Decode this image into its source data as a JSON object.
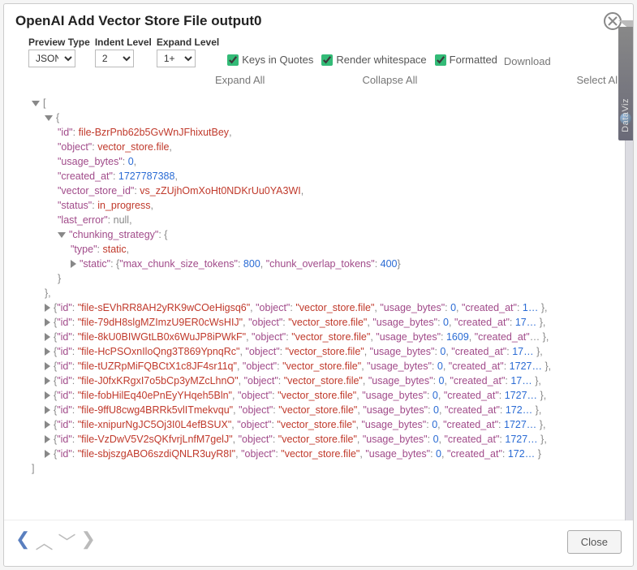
{
  "title": "OpenAI Add Vector Store File output0",
  "toolbar": {
    "preview_type_label": "Preview Type",
    "preview_type_value": "JSON",
    "indent_label": "Indent Level",
    "indent_value": "2",
    "expand_label": "Expand Level",
    "expand_value": "1+",
    "keys_in_quotes_label": "Keys in Quotes",
    "keys_in_quotes": true,
    "render_ws_label": "Render whitespace",
    "render_ws": true,
    "formatted_label": "Formatted",
    "formatted": true,
    "download_label": "Download",
    "expand_all_label": "Expand All",
    "collapse_all_label": "Collapse All",
    "select_all_label": "Select All"
  },
  "side_tab_label": "DataViz",
  "json": {
    "root_open": "[",
    "root_close": "]",
    "first_item": {
      "id_key": "\"id\"",
      "id_val": "file-BzrPnb62b5GvWnJFhixutBey",
      "object_key": "\"object\"",
      "object_val": "vector_store.file",
      "usage_key": "\"usage_bytes\"",
      "usage_val": "0",
      "created_key": "\"created_at\"",
      "created_val": "1727787388",
      "vsid_key": "\"vector_store_id\"",
      "vsid_val": "vs_zZUjhOmXoHt0NDKrUu0YA3WI",
      "status_key": "\"status\"",
      "status_val": "in_progress",
      "lasterr_key": "\"last_error\"",
      "lasterr_val": "null",
      "chunk_key": "\"chunking_strategy\"",
      "type_key": "\"type\"",
      "type_val": "static",
      "static_key": "\"static\"",
      "max_key": "\"max_chunk_size_tokens\"",
      "max_val": "800",
      "overlap_key": "\"chunk_overlap_tokens\"",
      "overlap_val": "400"
    },
    "collapsed": [
      {
        "id": "file-sEVhRR8AH2yRK9wCOeHigsq6",
        "object": "vector_store.file",
        "usage": "0",
        "created": "1…"
      },
      {
        "id": "file-79dH8slgMZImzU9ER0cWsHIJ",
        "object": "vector_store.file",
        "usage": "0",
        "created": "17…"
      },
      {
        "id": "file-8kU0BIWGtLB0x6WuJP8iPWkF",
        "object": "vector_store.file",
        "usage": "1609",
        "created": ""
      },
      {
        "id": "file-HcPSOxnIloQng3T869YpnqRc",
        "object": "vector_store.file",
        "usage": "0",
        "created": "17…"
      },
      {
        "id": "file-tUZRpMiFQBCtX1c8JF4sr11q",
        "object": "vector_store.file",
        "usage": "0",
        "created": "1727…"
      },
      {
        "id": "file-J0fxKRgxI7o5bCp3yMZcLhnO",
        "object": "vector_store.file",
        "usage": "0",
        "created": "17…"
      },
      {
        "id": "file-fobHilEq40ePnEyYHqeh5Bln",
        "object": "vector_store.file",
        "usage": "0",
        "created": "1727…"
      },
      {
        "id": "file-9ffU8cwg4BRRk5vlITmekvqu",
        "object": "vector_store.file",
        "usage": "0",
        "created": "172…"
      },
      {
        "id": "file-xnipurNgJC5Oj3I0L4efBSUX",
        "object": "vector_store.file",
        "usage": "0",
        "created": "1727…"
      },
      {
        "id": "file-VzDwV5V2sQKfvrjLnfM7gelJ",
        "object": "vector_store.file",
        "usage": "0",
        "created": "1727…"
      },
      {
        "id": "file-sbjszgABO6szdiQNLR3uyR8I",
        "object": "vector_store.file",
        "usage": "0",
        "created": "172…"
      }
    ]
  },
  "footer": {
    "close_label": "Close"
  }
}
